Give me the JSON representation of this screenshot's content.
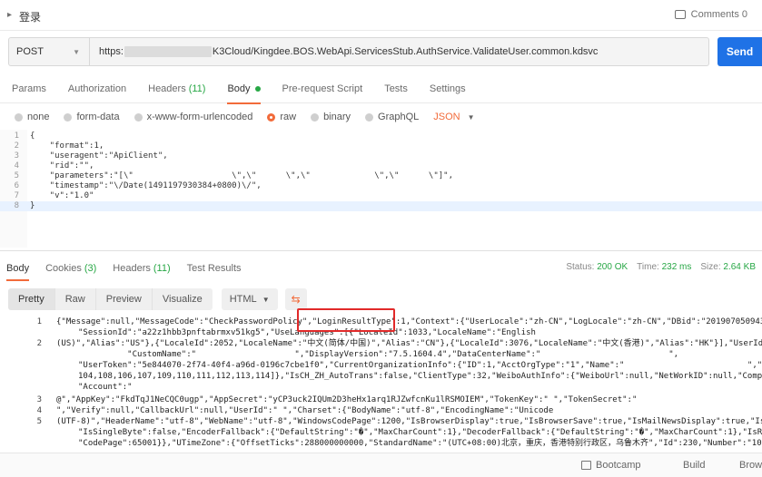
{
  "topbar": {
    "title": "登录",
    "comments": "Comments 0"
  },
  "request": {
    "method": "POST",
    "url_prefix": "https:",
    "url_suffix": "K3Cloud/Kingdee.BOS.WebApi.ServicesStub.AuthService.ValidateUser.common.kdsvc",
    "send_label": "Send"
  },
  "req_tabs": [
    {
      "label": "Params",
      "count": ""
    },
    {
      "label": "Authorization",
      "count": ""
    },
    {
      "label": "Headers",
      "count": "(11)"
    },
    {
      "label": "Body",
      "count": ""
    },
    {
      "label": "Pre-request Script",
      "count": ""
    },
    {
      "label": "Tests",
      "count": ""
    },
    {
      "label": "Settings",
      "count": ""
    }
  ],
  "body_types": [
    "none",
    "form-data",
    "x-www-form-urlencoded",
    "raw",
    "binary",
    "GraphQL"
  ],
  "body_format": "JSON",
  "request_body": [
    {
      "n": "1",
      "t": "{"
    },
    {
      "n": "2",
      "t": "    \"format\":1,"
    },
    {
      "n": "3",
      "t": "    \"useragent\":\"ApiClient\","
    },
    {
      "n": "4",
      "t": "    \"rid\":\"\","
    },
    {
      "n": "5",
      "t": "    \"parameters\":\"[\\\"                    \\\",\\\"      \\\",\\\"             \\\",\\\"      \\\"]\","
    },
    {
      "n": "6",
      "t": "    \"timestamp\":\"\\/Date(1491197930384+0800)\\/\","
    },
    {
      "n": "7",
      "t": "    \"v\":\"1.0\""
    },
    {
      "n": "8",
      "t": "}"
    }
  ],
  "resp_tabs": [
    {
      "label": "Body",
      "count": ""
    },
    {
      "label": "Cookies",
      "count": "(3)"
    },
    {
      "label": "Headers",
      "count": "(11)"
    },
    {
      "label": "Test Results",
      "count": ""
    }
  ],
  "status": {
    "status_label": "Status:",
    "status_value": "200 OK",
    "time_label": "Time:",
    "time_value": "232 ms",
    "size_label": "Size:",
    "size_value": "2.64 KB"
  },
  "resp_views": [
    "Pretty",
    "Raw",
    "Preview",
    "Visualize"
  ],
  "resp_format": "HTML",
  "response_lines": [
    {
      "n": "1",
      "cont": false,
      "t": "{\"Message\":null,\"MessageCode\":\"CheckPasswordPolicy\",\"LoginResultType\":1,\"Context\":{\"UserLocale\":\"zh-CN\",\"LogLocale\":\"zh-CN\",\"DBid\":\"20190705094325\",\"Da"
    },
    {
      "n": "",
      "cont": true,
      "t": "\"SessionId\":\"a22z1hbb3pnftabrmxv51kg5\",\"UseLanguages\":[{\"LocaleId\":1033,\"LocaleName\":\"English"
    },
    {
      "n": "2",
      "cont": false,
      "t": "(US)\",\"Alias\":\"US\"},{\"LocaleId\":2052,\"LocaleName\":\"中文(简体/中国)\",\"Alias\":\"CN\"},{\"LocaleId\":3076,\"LocaleName\":\"中文(香港)\",\"Alias\":\"HK\"}],\"UserId\":140"
    },
    {
      "n": "",
      "cont": true,
      "t": "          \"CustomName\":\"                    \",\"DisplayVersion\":\"7.5.1604.4\",\"DataCenterName\":\"                          \","
    },
    {
      "n": "",
      "cont": true,
      "t": "\"UserToken\":\"5e844070-2f74-40f4-a96d-0196c7cbe1f0\",\"CurrentOrganizationInfo\":{\"ID\":1,\"AcctOrgType\":\"1\",\"Name\":\"                         \",\"FunctionIds"
    },
    {
      "n": "",
      "cont": true,
      "t": "104,108,106,107,109,110,111,112,113,114]},\"IsCH_ZH_AutoTrans\":false,\"ClientType\":32,\"WeiboAuthInfo\":{\"WeiboUrl\":null,\"NetWorkID\":null,\"CompanyNetwo"
    },
    {
      "n": "",
      "cont": true,
      "t": "\"Account\":\""
    },
    {
      "n": "3",
      "cont": false,
      "t": "@\",\"AppKey\":\"FkdTqJ1NeCQC0ugp\",\"AppSecret\":\"yCP3uck2IQUm2D3heHx1arq1RJZwfcnKu1lRSMOIEM\",\"TokenKey\":\" \",\"TokenSecret\":\""
    },
    {
      "n": "4",
      "cont": false,
      "t": "\",\"Verify\":null,\"CallbackUrl\":null,\"UserId\":\" \",\"Charset\":{\"BodyName\":\"utf-8\",\"EncodingName\":\"Unicode"
    },
    {
      "n": "5",
      "cont": false,
      "t": "(UTF-8)\",\"HeaderName\":\"utf-8\",\"WebName\":\"utf-8\",\"WindowsCodePage\":1200,\"IsBrowserDisplay\":true,\"IsBrowserSave\":true,\"IsMailNewsDisplay\":true,\"IsMailNew"
    },
    {
      "n": "",
      "cont": true,
      "t": "\"IsSingleByte\":false,\"EncoderFallback\":{\"DefaultString\":\"�\",\"MaxCharCount\":1},\"DecoderFallback\":{\"DefaultString\":\"�\",\"MaxCharCount\":1},\"IsReadOnl"
    },
    {
      "n": "",
      "cont": true,
      "t": "\"CodePage\":65001}},\"UTimeZone\":{\"OffsetTicks\":288000000000,\"StandardName\":\"(UTC+08:00)北京，重庆，香港特别行政区，乌鲁木齐\",\"Id\":230,\"Number\":\"1078_SY"
    }
  ],
  "footer": {
    "bootcamp": "Bootcamp",
    "build": "Build",
    "browse": "Brows"
  }
}
